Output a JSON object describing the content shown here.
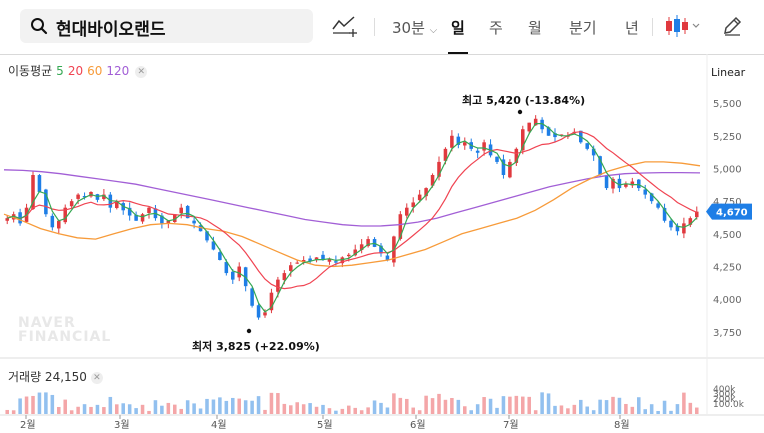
{
  "search": {
    "query": "현대바이오랜드"
  },
  "toolbar": {
    "interval": "30분",
    "periods": [
      "일",
      "주",
      "월",
      "분기",
      "년"
    ],
    "active_period": "일"
  },
  "ma_legend": {
    "title": "이동평균",
    "periods": [
      "5",
      "20",
      "60",
      "120"
    ]
  },
  "colors": {
    "up": "#e0393e",
    "down": "#1e7ee6",
    "ma5": "#35a853",
    "ma20": "#f04452",
    "ma60": "#f79b3a",
    "ma120": "#a25fd6",
    "price_tag": "#1e7ee6"
  },
  "scale_mode": "Linear",
  "annotations": {
    "high": "최고 5,420 (-13.84%)",
    "low": "최저 3,825 (+22.09%)"
  },
  "current_price": "4,670",
  "volume_legend": {
    "label": "거래량 24,150"
  },
  "watermark": [
    "NAVER",
    "FINANCIAL"
  ],
  "chart_data": {
    "type": "candlestick",
    "x_ticks": [
      "2월",
      "3월",
      "4월",
      "5월",
      "6월",
      "7월",
      "8월"
    ],
    "y_ticks": [
      "5,500",
      "5,250",
      "5,000",
      "4,750",
      "4,500",
      "4,250",
      "4,000",
      "3,750"
    ],
    "ylim": [
      3650,
      5600
    ],
    "volume_ticks": [
      "400k",
      "300k",
      "200k",
      "100.0k"
    ],
    "closes": [
      4620,
      4650,
      4580,
      4700,
      4950,
      4820,
      4650,
      4550,
      4600,
      4700,
      4750,
      4800,
      4780,
      4820,
      4760,
      4800,
      4700,
      4750,
      4680,
      4640,
      4600,
      4650,
      4700,
      4620,
      4580,
      4600,
      4650,
      4700,
      4620,
      4580,
      4520,
      4450,
      4380,
      4300,
      4200,
      4150,
      4250,
      4100,
      3950,
      3860,
      3900,
      4050,
      4150,
      4200,
      4260,
      4280,
      4300,
      4290,
      4320,
      4300,
      4310,
      4280,
      4320,
      4340,
      4380,
      4420,
      4460,
      4400,
      4350,
      4300,
      4480,
      4650,
      4700,
      4740,
      4800,
      4850,
      4950,
      5050,
      5150,
      5250,
      5180,
      5200,
      5150,
      5120,
      5200,
      5100,
      5050,
      4950,
      5050,
      5150,
      5300,
      5350,
      5380,
      5300,
      5250,
      5240,
      5260,
      5250,
      5280,
      5200,
      5150,
      5100,
      4950,
      4850,
      4920,
      4850,
      4880,
      4900,
      4850,
      4800,
      4750,
      4700,
      4600,
      4550,
      4520,
      4580,
      4620,
      4670
    ],
    "ma120": [
      4990,
      4985,
      4975,
      4960,
      4940,
      4920,
      4900,
      4880,
      4850,
      4820,
      4790,
      4760,
      4730,
      4700,
      4670,
      4640,
      4610,
      4590,
      4570,
      4560,
      4560,
      4570,
      4590,
      4620,
      4660,
      4700,
      4740,
      4780,
      4820,
      4860,
      4890,
      4920,
      4945,
      4960,
      4965,
      4968,
      4968,
      4966
    ],
    "ma60": [
      4650,
      4600,
      4540,
      4500,
      4470,
      4460,
      4500,
      4540,
      4570,
      4580,
      4570,
      4540,
      4520,
      4480,
      4420,
      4360,
      4300,
      4260,
      4250,
      4260,
      4280,
      4300,
      4340,
      4380,
      4440,
      4500,
      4540,
      4580,
      4620,
      4680,
      4760,
      4850,
      4920,
      4980,
      5020,
      5050,
      5050,
      5040,
      5020
    ]
  }
}
